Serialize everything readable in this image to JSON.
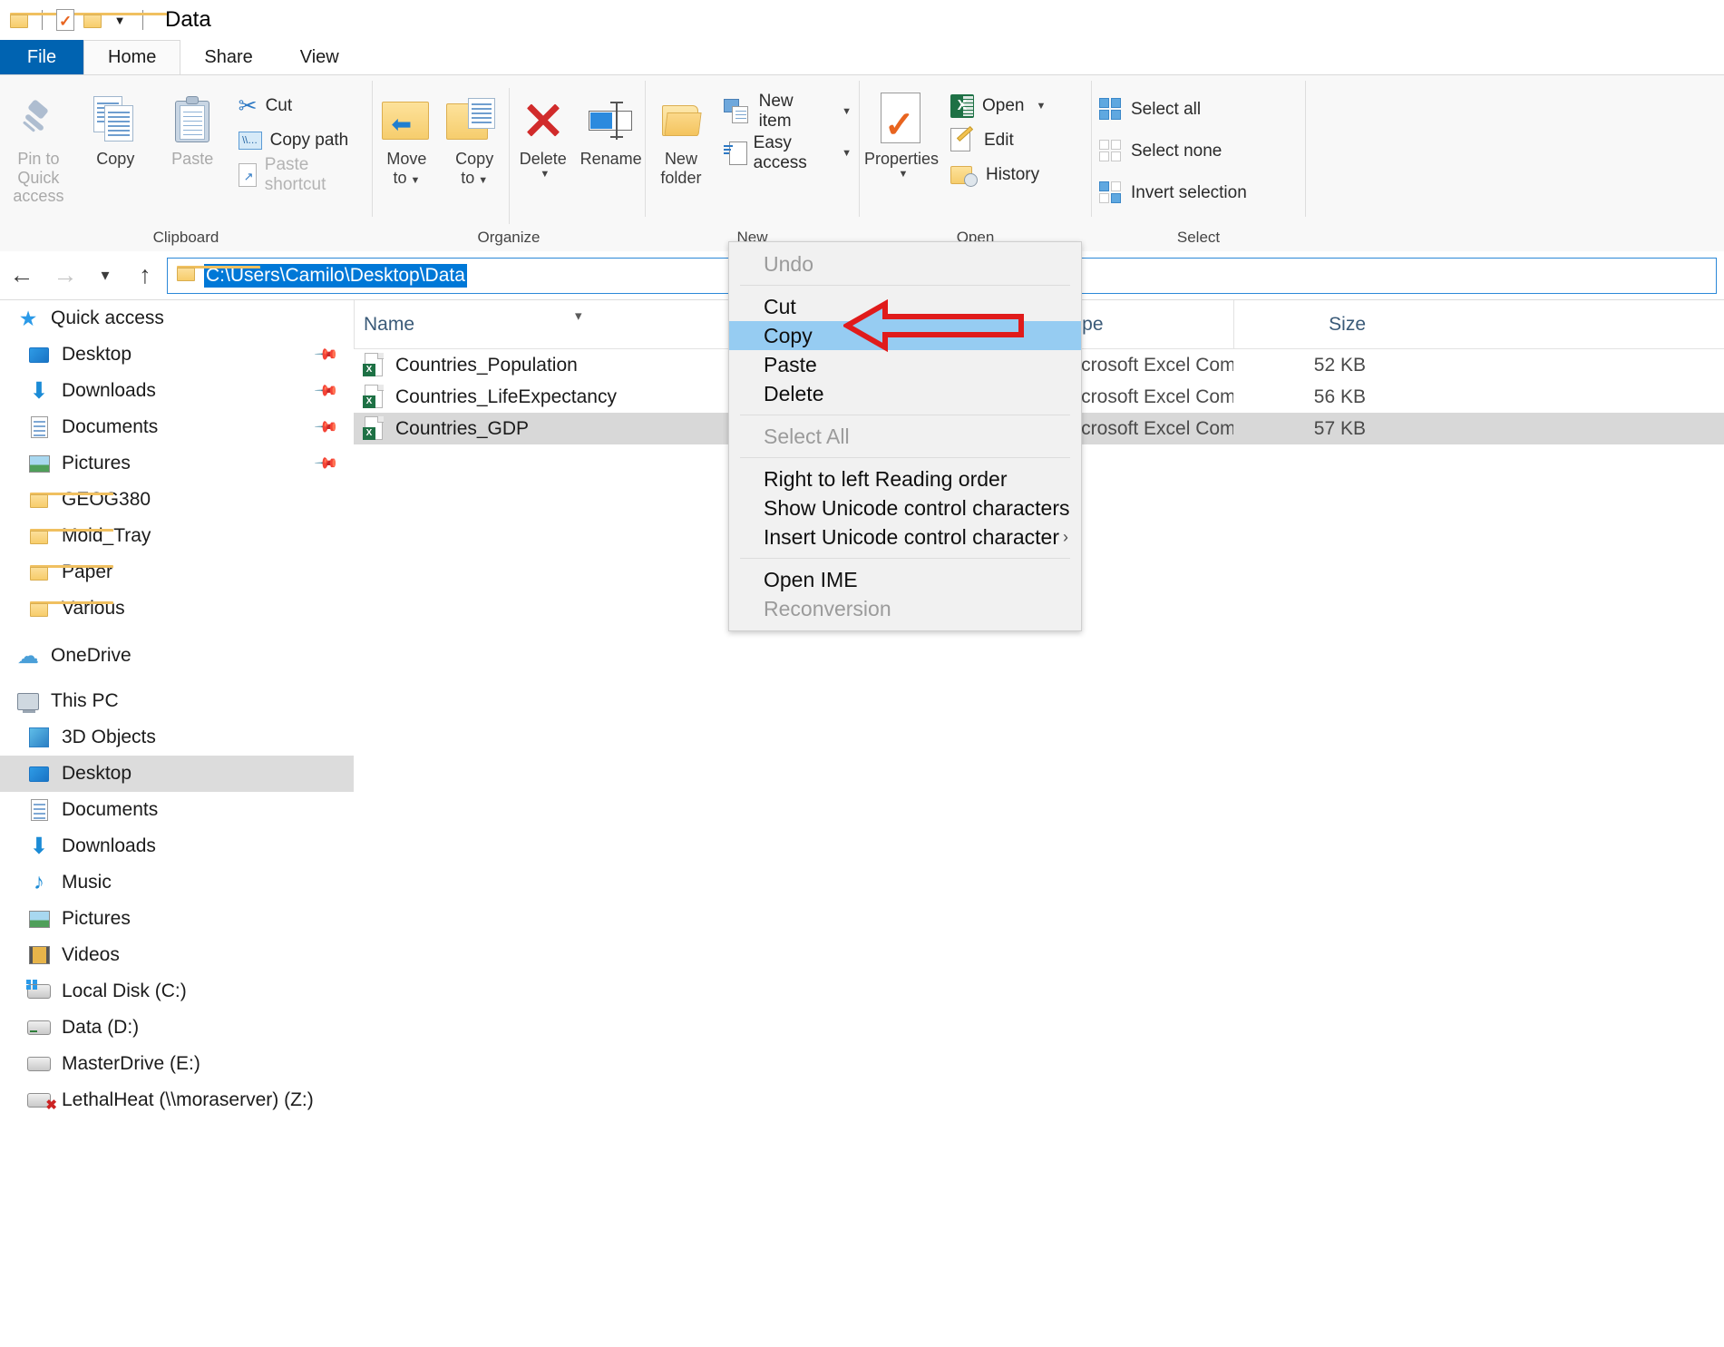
{
  "window": {
    "title": "Data",
    "qat": [
      {
        "name": "folder-icon"
      },
      {
        "name": "properties-check-icon"
      },
      {
        "name": "new-folder-icon"
      },
      {
        "name": "chevron-down-icon",
        "glyph": "▾"
      }
    ]
  },
  "ribbon": {
    "tabs": [
      {
        "label": "File",
        "kind": "file"
      },
      {
        "label": "Home",
        "kind": "active"
      },
      {
        "label": "Share",
        "kind": "normal"
      },
      {
        "label": "View",
        "kind": "normal"
      }
    ],
    "groups": [
      {
        "label": "Clipboard",
        "big": [
          {
            "label": "Pin to Quick access",
            "icon": "pin-icon",
            "dim": true
          },
          {
            "label": "Copy",
            "icon": "copy-pages-icon",
            "dim": false
          },
          {
            "label": "Paste",
            "icon": "clipboard-icon",
            "dim": true
          }
        ],
        "small": [
          {
            "label": "Cut",
            "icon": "scissors-icon",
            "dim": false
          },
          {
            "label": "Copy path",
            "icon": "copy-path-icon",
            "dim": false
          },
          {
            "label": "Paste shortcut",
            "icon": "paste-shortcut-icon",
            "dim": true
          }
        ]
      },
      {
        "label": "Organize",
        "big": [
          {
            "label": "Move to",
            "icon": "move-to-icon",
            "caret": true
          },
          {
            "label": "Copy to",
            "icon": "copy-to-icon",
            "caret": true
          },
          {
            "label": "Delete",
            "icon": "delete-x-icon",
            "caret": true
          },
          {
            "label": "Rename",
            "icon": "rename-icon",
            "caret": false
          }
        ]
      },
      {
        "label": "New",
        "big": [
          {
            "label": "New folder",
            "icon": "new-folder-icon",
            "caret": false
          }
        ],
        "small": [
          {
            "label": "New item",
            "icon": "new-item-icon",
            "caret": true
          },
          {
            "label": "Easy access",
            "icon": "easy-access-icon",
            "caret": true
          }
        ]
      },
      {
        "label": "Open",
        "big": [
          {
            "label": "Properties",
            "icon": "properties-icon",
            "caret": true
          }
        ],
        "small": [
          {
            "label": "Open",
            "icon": "excel-open-icon",
            "caret": true
          },
          {
            "label": "Edit",
            "icon": "edit-pencil-icon",
            "caret": false
          },
          {
            "label": "History",
            "icon": "history-icon",
            "caret": false
          }
        ]
      },
      {
        "label": "Select",
        "small": [
          {
            "label": "Select all",
            "icon": "select-all-icon"
          },
          {
            "label": "Select none",
            "icon": "select-none-icon"
          },
          {
            "label": "Invert selection",
            "icon": "invert-selection-icon"
          }
        ]
      }
    ]
  },
  "addressbar": {
    "back_icon": "back-arrow-icon",
    "forward_icon": "forward-arrow-icon",
    "recent_icon": "chevron-down-icon",
    "up_icon": "up-arrow-icon",
    "path_text": "C:\\Users\\Camilo\\Desktop\\Data",
    "folder_icon": "folder-icon"
  },
  "sidebar": {
    "items": [
      {
        "label": "Quick access",
        "icon": "star-icon",
        "indent": "root",
        "pinned": false,
        "selected": false
      },
      {
        "label": "Desktop",
        "icon": "desktop-icon",
        "indent": "child",
        "pinned": true,
        "selected": false
      },
      {
        "label": "Downloads",
        "icon": "downloads-icon",
        "indent": "child",
        "pinned": true,
        "selected": false
      },
      {
        "label": "Documents",
        "icon": "documents-icon",
        "indent": "child",
        "pinned": true,
        "selected": false
      },
      {
        "label": "Pictures",
        "icon": "pictures-icon",
        "indent": "child",
        "pinned": true,
        "selected": false
      },
      {
        "label": "GEOG380",
        "icon": "folder-icon",
        "indent": "child",
        "pinned": false,
        "selected": false
      },
      {
        "label": "Mold_Tray",
        "icon": "folder-icon",
        "indent": "child",
        "pinned": false,
        "selected": false
      },
      {
        "label": "Paper",
        "icon": "folder-icon",
        "indent": "child",
        "pinned": false,
        "selected": false
      },
      {
        "label": "Various",
        "icon": "folder-icon",
        "indent": "child",
        "pinned": false,
        "selected": false
      },
      {
        "label": "OneDrive",
        "icon": "cloud-icon",
        "indent": "root",
        "pinned": false,
        "selected": false
      },
      {
        "label": "This PC",
        "icon": "this-pc-icon",
        "indent": "root",
        "pinned": false,
        "selected": false
      },
      {
        "label": "3D Objects",
        "icon": "3d-objects-icon",
        "indent": "child",
        "pinned": false,
        "selected": false
      },
      {
        "label": "Desktop",
        "icon": "desktop-icon",
        "indent": "child",
        "pinned": false,
        "selected": true
      },
      {
        "label": "Documents",
        "icon": "documents-icon",
        "indent": "child",
        "pinned": false,
        "selected": false
      },
      {
        "label": "Downloads",
        "icon": "downloads-icon",
        "indent": "child",
        "pinned": false,
        "selected": false
      },
      {
        "label": "Music",
        "icon": "music-icon",
        "indent": "child",
        "pinned": false,
        "selected": false
      },
      {
        "label": "Pictures",
        "icon": "pictures-icon",
        "indent": "child",
        "pinned": false,
        "selected": false
      },
      {
        "label": "Videos",
        "icon": "videos-icon",
        "indent": "child",
        "pinned": false,
        "selected": false
      },
      {
        "label": "Local Disk (C:)",
        "icon": "local-disk-icon",
        "indent": "child",
        "pinned": false,
        "selected": false
      },
      {
        "label": "Data (D:)",
        "icon": "drive-icon",
        "indent": "child",
        "pinned": false,
        "selected": false
      },
      {
        "label": "MasterDrive (E:)",
        "icon": "drive-icon",
        "indent": "child",
        "pinned": false,
        "selected": false
      },
      {
        "label": "LethalHeat (\\\\moraserver) (Z:)",
        "icon": "network-drive-disconnected-icon",
        "indent": "child",
        "pinned": false,
        "selected": false
      }
    ]
  },
  "filelist": {
    "columns": [
      "Name",
      "Type",
      "Size"
    ],
    "rows": [
      {
        "name": "Countries_Population",
        "type": "Microsoft Excel Com...",
        "size": "52 KB",
        "icon": "excel-file-icon",
        "selected": false
      },
      {
        "name": "Countries_LifeExpectancy",
        "type": "Microsoft Excel Com...",
        "size": "56 KB",
        "icon": "excel-file-icon",
        "selected": false
      },
      {
        "name": "Countries_GDP",
        "type": "Microsoft Excel Com...",
        "size": "57 KB",
        "icon": "excel-file-icon",
        "selected": true
      }
    ]
  },
  "contextmenu": {
    "items": [
      {
        "label": "Undo",
        "state": "disabled"
      },
      {
        "sep": true
      },
      {
        "label": "Cut",
        "state": "normal"
      },
      {
        "label": "Copy",
        "state": "highlighted"
      },
      {
        "label": "Paste",
        "state": "normal"
      },
      {
        "label": "Delete",
        "state": "normal"
      },
      {
        "sep": true
      },
      {
        "label": "Select All",
        "state": "disabled"
      },
      {
        "sep": true
      },
      {
        "label": "Right to left Reading order",
        "state": "normal"
      },
      {
        "label": "Show Unicode control characters",
        "state": "normal"
      },
      {
        "label": "Insert Unicode control character",
        "state": "normal",
        "submenu": true
      },
      {
        "sep": true
      },
      {
        "label": "Open IME",
        "state": "normal"
      },
      {
        "label": "Reconversion",
        "state": "disabled"
      }
    ]
  },
  "annotation": {
    "type": "arrow-pointing-left",
    "target": "Copy",
    "stroke_color": "#e01b1b",
    "fill_color": "#96ccf2"
  },
  "colors": {
    "accent": "#0078d7",
    "file_tab": "#0063b1",
    "selection_gray": "#d8d8d8",
    "menu_highlight": "#96ccf2"
  }
}
